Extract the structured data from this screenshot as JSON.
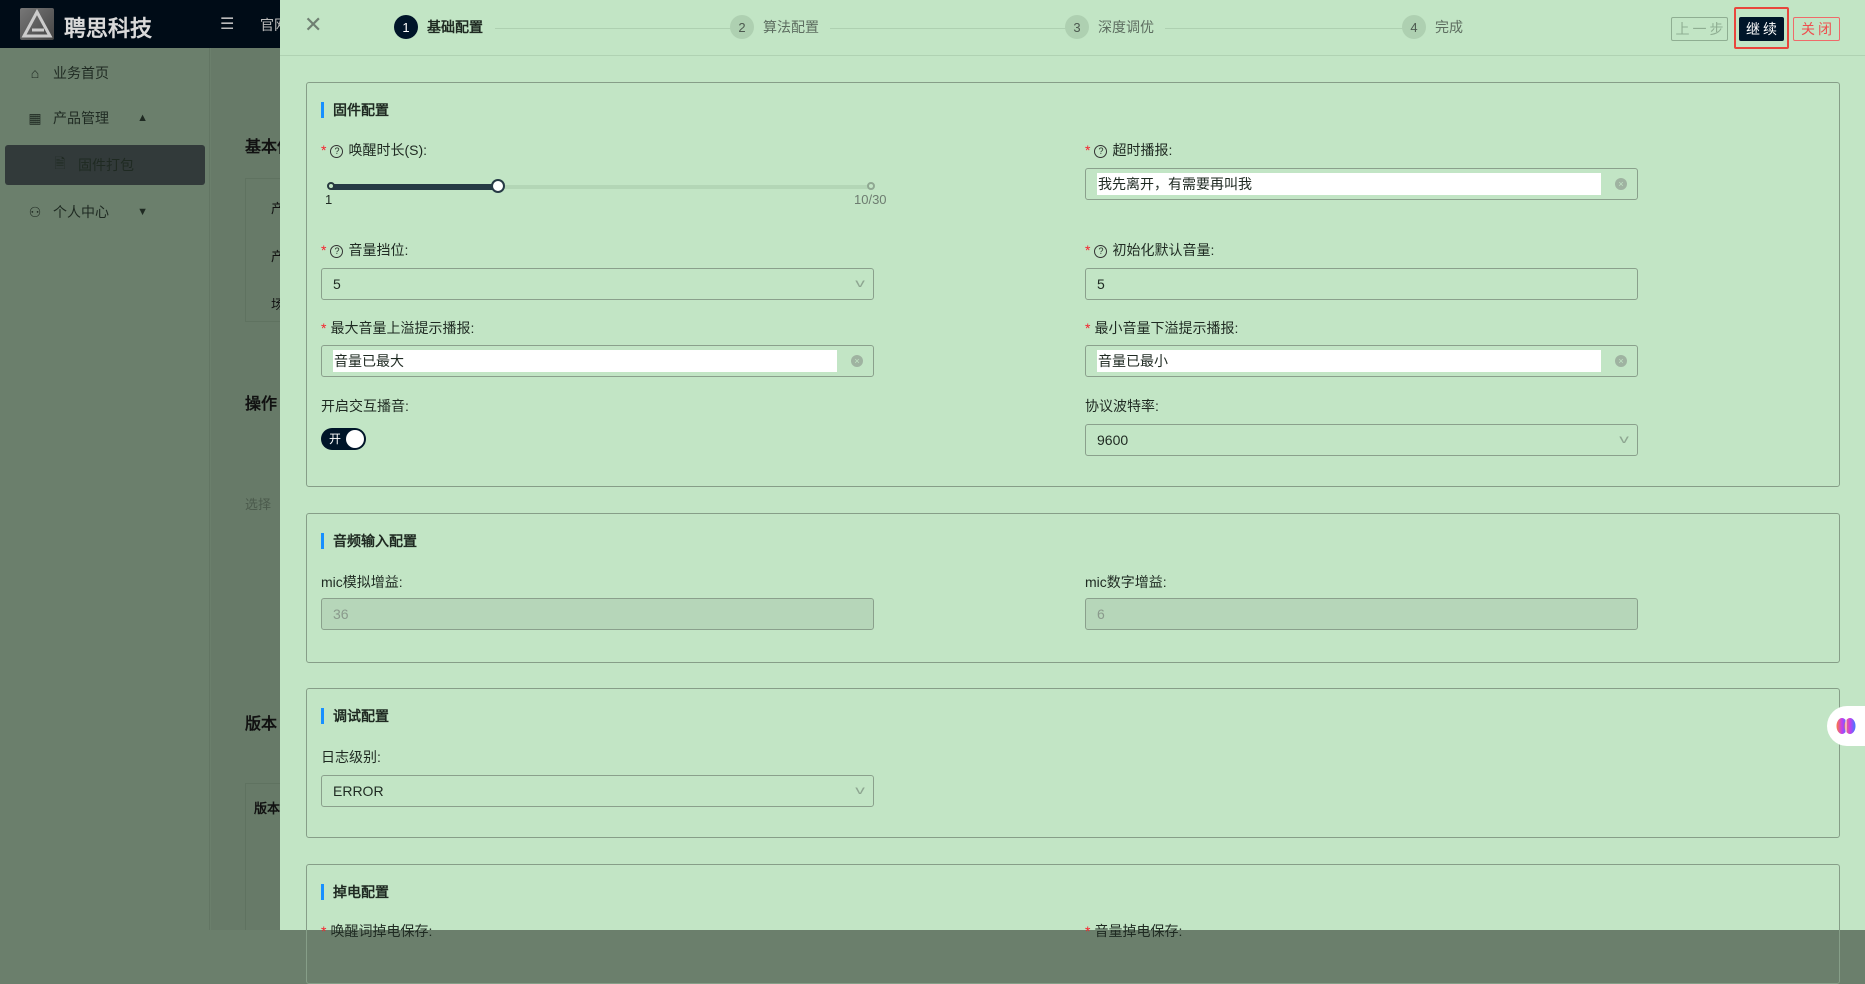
{
  "app": {
    "brand": "聘思科技",
    "top_nav": "官网"
  },
  "sidebar": {
    "items": [
      {
        "label": "业务首页",
        "icon": "home-icon"
      },
      {
        "label": "产品管理",
        "icon": "grid-icon"
      },
      {
        "label": "固件打包",
        "icon": "file-icon"
      },
      {
        "label": "个人中心",
        "icon": "user-icon"
      }
    ]
  },
  "background": {
    "basic_info": "基本信",
    "rows": [
      "产",
      "产",
      "场"
    ],
    "operation": "操作",
    "select_hint": "选择",
    "version": "版本",
    "version_col": "版本"
  },
  "drawer": {
    "steps": [
      {
        "num": "1",
        "label": "基础配置"
      },
      {
        "num": "2",
        "label": "算法配置"
      },
      {
        "num": "3",
        "label": "深度调优"
      },
      {
        "num": "4",
        "label": "完成"
      }
    ],
    "buttons": {
      "prev": "上一步",
      "next": "继续",
      "close": "关闭"
    },
    "firmware": {
      "title": "固件配置",
      "wake_duration": {
        "label": "唤醒时长(S):",
        "min": "1",
        "max_label": "10/30",
        "value": 10,
        "min_value": 1,
        "max_value": 30
      },
      "timeout_prompt": {
        "label": "超时播报:",
        "value": "我先离开，有需要再叫我"
      },
      "volume_level": {
        "label": "音量挡位:",
        "value": "5"
      },
      "default_volume": {
        "label": "初始化默认音量:",
        "value": "5"
      },
      "max_volume_prompt": {
        "label": "最大音量上溢提示播报:",
        "value": "音量已最大"
      },
      "min_volume_prompt": {
        "label": "最小音量下溢提示播报:",
        "value": "音量已最小"
      },
      "interactive_sound": {
        "label": "开启交互播音:",
        "state": "开"
      },
      "baud_rate": {
        "label": "协议波特率:",
        "value": "9600"
      }
    },
    "audio": {
      "title": "音频输入配置",
      "mic_analog": {
        "label": "mic模拟增益:",
        "value": "36"
      },
      "mic_digital": {
        "label": "mic数字增益:",
        "value": "6"
      }
    },
    "debug": {
      "title": "调试配置",
      "log_level": {
        "label": "日志级别:",
        "value": "ERROR"
      }
    },
    "power": {
      "title": "掉电配置",
      "wake_word_save": "唤醒词掉电保存:",
      "volume_save": "音量掉电保存:"
    }
  }
}
